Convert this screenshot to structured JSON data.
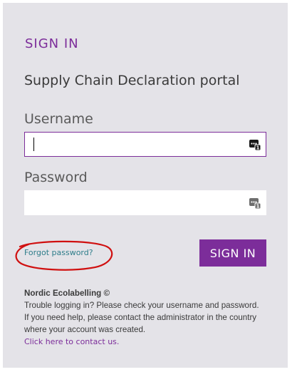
{
  "login": {
    "heading": "SIGN IN",
    "subtitle": "Supply Chain Declaration portal",
    "username_label": "Username",
    "username_value": "",
    "password_label": "Password",
    "password_value": "",
    "forgot_link": "Forgot password?",
    "signin_button": "SIGN IN"
  },
  "footer": {
    "org": "Nordic Ecolabelling ©",
    "line1": "Trouble logging in? Please check your username and password.",
    "line2": "If you need help, please contact the administrator in the country",
    "line3": "where your account was created.",
    "contact_link": "Click here to contact us."
  },
  "colors": {
    "accent": "#7c2d9a",
    "link": "#2e7d8a",
    "panel_bg": "#e4e3e8",
    "annotation": "#d01010"
  },
  "icons": {
    "username_field": "password-manager-icon",
    "password_field": "password-manager-icon"
  }
}
